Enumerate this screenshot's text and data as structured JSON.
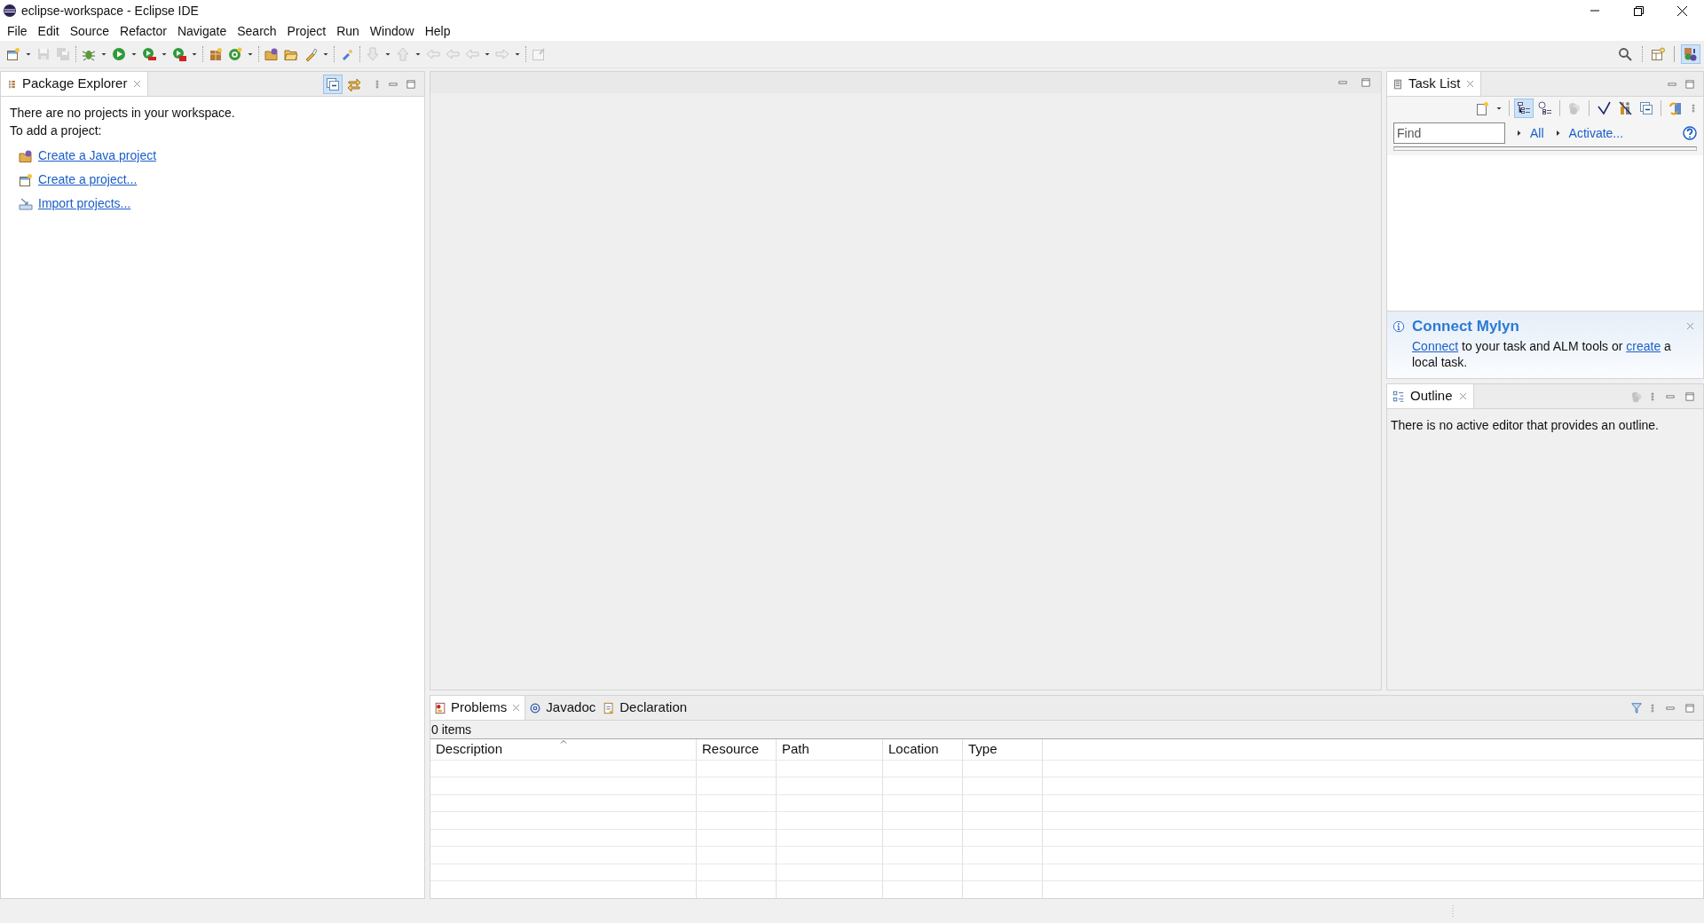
{
  "window": {
    "title": "eclipse-workspace - Eclipse IDE"
  },
  "menu": [
    "File",
    "Edit",
    "Source",
    "Refactor",
    "Navigate",
    "Search",
    "Project",
    "Run",
    "Window",
    "Help"
  ],
  "toolbar": [
    {
      "kind": "new",
      "dropdown": true,
      "disabled": false
    },
    {
      "kind": "save",
      "dropdown": false,
      "disabled": true
    },
    {
      "kind": "save-all",
      "dropdown": false,
      "disabled": true
    },
    {
      "kind": "separator"
    },
    {
      "kind": "debug",
      "dropdown": true,
      "disabled": false
    },
    {
      "kind": "run",
      "dropdown": true,
      "disabled": false
    },
    {
      "kind": "coverage",
      "dropdown": true,
      "disabled": false
    },
    {
      "kind": "external",
      "dropdown": true,
      "disabled": false
    },
    {
      "kind": "separator"
    },
    {
      "kind": "new-package",
      "dropdown": false,
      "disabled": false
    },
    {
      "kind": "new-class",
      "dropdown": true,
      "disabled": false
    },
    {
      "kind": "separator"
    },
    {
      "kind": "open-type",
      "dropdown": false,
      "disabled": false
    },
    {
      "kind": "open-folder",
      "dropdown": false,
      "disabled": false
    },
    {
      "kind": "search",
      "dropdown": true,
      "disabled": false
    },
    {
      "kind": "separator"
    },
    {
      "kind": "mark",
      "dropdown": false,
      "disabled": false
    },
    {
      "kind": "separator"
    },
    {
      "kind": "next",
      "dropdown": true,
      "disabled": true
    },
    {
      "kind": "prev",
      "dropdown": true,
      "disabled": true
    },
    {
      "kind": "last-edit",
      "dropdown": false,
      "disabled": true
    },
    {
      "kind": "last-edit",
      "dropdown": false,
      "disabled": true
    },
    {
      "kind": "back",
      "dropdown": true,
      "disabled": true
    },
    {
      "kind": "forward",
      "dropdown": true,
      "disabled": true
    },
    {
      "kind": "separator"
    },
    {
      "kind": "pin",
      "dropdown": false,
      "disabled": true
    }
  ],
  "perspectives": [
    {
      "kind": "open-perspective",
      "selected": false
    },
    {
      "kind": "java",
      "selected": true
    }
  ],
  "package_explorer": {
    "title": "Package Explorer",
    "selected": true,
    "toolbar": [
      {
        "kind": "collapse",
        "selected": true
      },
      {
        "kind": "link",
        "selected": false
      }
    ],
    "message": [
      "There are no projects in your workspace.",
      "To add a project:"
    ],
    "links": [
      {
        "kind": "java-project",
        "label": "Create a Java project"
      },
      {
        "kind": "project",
        "label": "Create a project..."
      },
      {
        "kind": "import",
        "label": "Import projects..."
      }
    ]
  },
  "task_list": {
    "title": "Task List",
    "selected": true,
    "toolbar": [
      {
        "kind": "new-task",
        "selected": false,
        "disabled": false
      },
      {
        "kind": "separator"
      },
      {
        "kind": "categorized",
        "selected": true,
        "disabled": false
      },
      {
        "kind": "scheduled",
        "selected": false,
        "disabled": false
      },
      {
        "kind": "separator"
      },
      {
        "kind": "focus",
        "selected": false,
        "disabled": true
      },
      {
        "kind": "separator"
      },
      {
        "kind": "complete",
        "selected": false,
        "disabled": false
      },
      {
        "kind": "filter",
        "selected": false,
        "disabled": false
      },
      {
        "kind": "collapse",
        "selected": false,
        "disabled": false
      },
      {
        "kind": "separator"
      },
      {
        "kind": "sync",
        "selected": false,
        "disabled": false
      }
    ],
    "find": {
      "placeholder": "Find"
    },
    "filters": [
      "All",
      "Activate..."
    ]
  },
  "mylyn": {
    "title": "Connect Mylyn",
    "message": [
      {
        "kind": "link",
        "text": "Connect"
      },
      {
        "kind": "text",
        "text": " to your task and ALM tools or "
      },
      {
        "kind": "link",
        "text": "create"
      },
      {
        "kind": "text",
        "text": " a local task."
      }
    ]
  },
  "outline": {
    "title": "Outline",
    "selected": true,
    "message": "There is no active editor that provides an outline."
  },
  "bottom_tabs": [
    {
      "kind": "problems",
      "label": "Problems",
      "selected": true
    },
    {
      "kind": "javadoc",
      "label": "Javadoc",
      "selected": false
    },
    {
      "kind": "declaration",
      "label": "Declaration",
      "selected": false
    }
  ],
  "problems": {
    "summary": "0 items",
    "columns": [
      {
        "label": "Description",
        "sorted": true
      },
      {
        "label": "Resource",
        "sorted": false
      },
      {
        "label": "Path",
        "sorted": false
      },
      {
        "label": "Location",
        "sorted": false
      },
      {
        "label": "Type",
        "sorted": false
      }
    ]
  }
}
